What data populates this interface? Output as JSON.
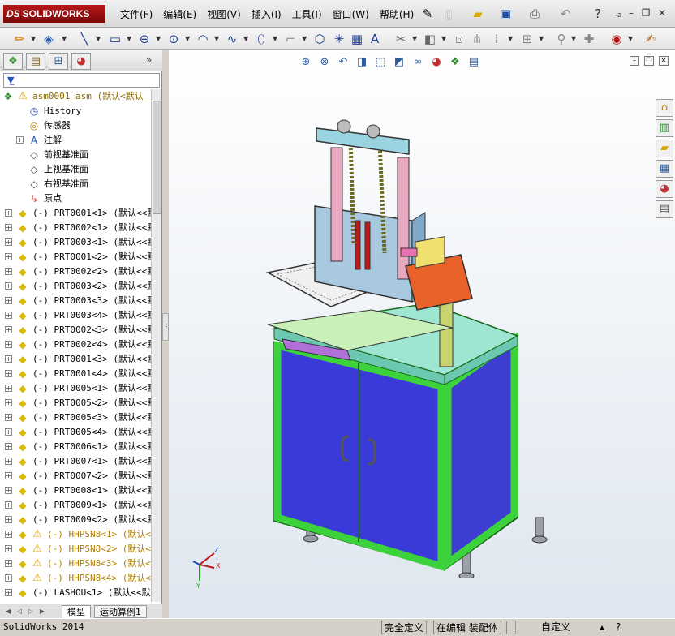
{
  "app": {
    "logo_prefix": "DS",
    "logo_name": "SOLIDWORKS"
  },
  "menu": [
    "文件(F)",
    "编辑(E)",
    "视图(V)",
    "插入(I)",
    "工具(I)",
    "窗口(W)",
    "帮助(H)"
  ],
  "title_toolbar": {
    "ad_label": "-a"
  },
  "panel_tabs": [
    "feature-manager",
    "property-manager",
    "configuration-manager",
    "display-manager"
  ],
  "tree": {
    "root": {
      "label": "asm0001_asm  (默认<默认_"
    },
    "items": [
      {
        "label": "History",
        "icon": "history-icon",
        "expand": false
      },
      {
        "label": "传感器",
        "icon": "sensor-icon",
        "expand": false
      },
      {
        "label": "注解",
        "icon": "annotation-icon",
        "expand": true
      },
      {
        "label": "前视基准面",
        "icon": "plane-icon",
        "expand": false
      },
      {
        "label": "上视基准面",
        "icon": "plane-icon",
        "expand": false
      },
      {
        "label": "右视基准面",
        "icon": "plane-icon",
        "expand": false
      },
      {
        "label": "原点",
        "icon": "origin-icon",
        "expand": false
      },
      {
        "label": "(-) PRT0001<1> (默认<<默",
        "icon": "part-icon",
        "expand": true
      },
      {
        "label": "(-) PRT0002<1> (默认<<默",
        "icon": "part-icon",
        "expand": true
      },
      {
        "label": "(-) PRT0003<1> (默认<<默",
        "icon": "part-icon",
        "expand": true
      },
      {
        "label": "(-) PRT0001<2> (默认<<默",
        "icon": "part-icon",
        "expand": true
      },
      {
        "label": "(-) PRT0002<2> (默认<<默",
        "icon": "part-icon",
        "expand": true
      },
      {
        "label": "(-) PRT0003<2> (默认<<默",
        "icon": "part-icon",
        "expand": true
      },
      {
        "label": "(-) PRT0003<3> (默认<<默",
        "icon": "part-icon",
        "expand": true
      },
      {
        "label": "(-) PRT0003<4> (默认<<默",
        "icon": "part-icon",
        "expand": true
      },
      {
        "label": "(-) PRT0002<3> (默认<<默",
        "icon": "part-icon",
        "expand": true
      },
      {
        "label": "(-) PRT0002<4> (默认<<默",
        "icon": "part-icon",
        "expand": true
      },
      {
        "label": "(-) PRT0001<3> (默认<<默",
        "icon": "part-icon",
        "expand": true
      },
      {
        "label": "(-) PRT0001<4> (默认<<默",
        "icon": "part-icon",
        "expand": true
      },
      {
        "label": "(-) PRT0005<1> (默认<<默",
        "icon": "part-icon",
        "expand": true
      },
      {
        "label": "(-) PRT0005<2> (默认<<默",
        "icon": "part-icon",
        "expand": true
      },
      {
        "label": "(-) PRT0005<3> (默认<<默",
        "icon": "part-icon",
        "expand": true
      },
      {
        "label": "(-) PRT0005<4> (默认<<默",
        "icon": "part-icon",
        "expand": true
      },
      {
        "label": "(-) PRT0006<1> (默认<<默",
        "icon": "part-icon",
        "expand": true
      },
      {
        "label": "(-) PRT0007<1> (默认<<默",
        "icon": "part-icon",
        "expand": true
      },
      {
        "label": "(-) PRT0007<2> (默认<<默",
        "icon": "part-icon",
        "expand": true
      },
      {
        "label": "(-) PRT0008<1> (默认<<默",
        "icon": "part-icon",
        "expand": true
      },
      {
        "label": "(-) PRT0009<1> (默认<<默",
        "icon": "part-icon",
        "expand": true
      },
      {
        "label": "(-) PRT0009<2> (默认<<默",
        "icon": "part-icon",
        "expand": true
      },
      {
        "label": "(-) HHPSN8<1> (默认<<",
        "icon": "part-icon",
        "expand": true,
        "warning": true
      },
      {
        "label": "(-) HHPSN8<2> (默认<<",
        "icon": "part-icon",
        "expand": true,
        "warning": true
      },
      {
        "label": "(-) HHPSN8<3> (默认<<",
        "icon": "part-icon",
        "expand": true,
        "warning": true
      },
      {
        "label": "(-) HHPSN8<4> (默认<<",
        "icon": "part-icon",
        "expand": true,
        "warning": true
      },
      {
        "label": "(-) LASHOU<1> (默认<<默",
        "icon": "part-icon",
        "expand": true
      }
    ]
  },
  "bottom_tabs": [
    "模型",
    "运动算例1"
  ],
  "status": {
    "app_name": "SolidWorks 2014",
    "definition": "完全定义",
    "editing": "在编辑 装配体",
    "custom": "自定义"
  },
  "triad": {
    "x": "X",
    "y": "Y",
    "z": "Z"
  },
  "colors": {
    "accent": "#b81818",
    "cabinet_frame": "#3cd23c",
    "cabinet_door": "#3a3ad8",
    "table": "#9ee6d2"
  }
}
